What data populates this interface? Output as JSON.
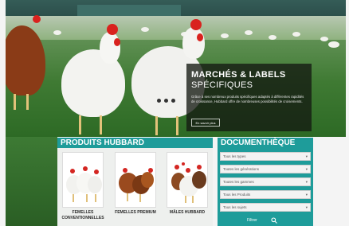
{
  "hero": {
    "title": "MARCHÉS & LABELS",
    "subtitle": "SPÉCIFIQUES",
    "description": "Grâce à ses nombreux produits spécifiques adaptés à différentes rapidités de croissance, Hubbard offre de nombreuses possibilités de croisements.",
    "button_label": "En savoir plus",
    "carousel_dots": 3
  },
  "products": {
    "title": "PRODUITS HUBBARD",
    "items": [
      {
        "label": "FEMELLES CONVENTIONNELLES"
      },
      {
        "label": "FEMELLES PREMIUM"
      },
      {
        "label": "MÂLES HUBBARD"
      }
    ]
  },
  "documentation": {
    "title": "DOCUMENTHÈQUE",
    "selects": [
      {
        "value": "Tous les types"
      },
      {
        "value": "Toutes les générations"
      },
      {
        "value": "Toutes les gammes"
      },
      {
        "value": "Tous les Produits"
      },
      {
        "value": "Tous les sujets"
      }
    ],
    "filter_label": "Filtrer"
  },
  "colors": {
    "accent": "#1e9c9a",
    "panel": "#141a12"
  }
}
